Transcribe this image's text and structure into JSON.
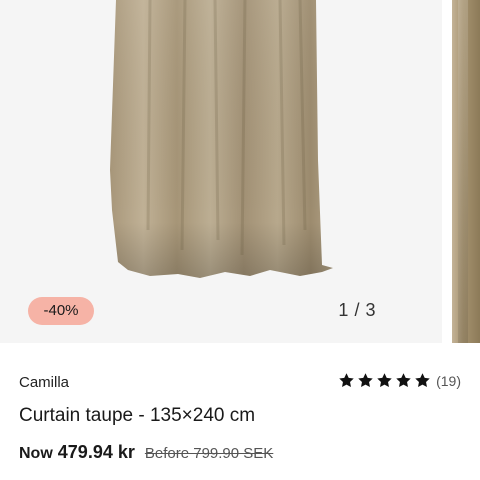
{
  "gallery": {
    "discount_badge": "-40%",
    "current_index": "1",
    "separator": "/",
    "total": "3"
  },
  "product": {
    "brand": "Camilla",
    "title": "Curtain taupe - 135×240 cm",
    "rating": 5,
    "review_count": "(19)",
    "price_label": "Now",
    "price": "479.94 kr",
    "before_price": "Before 799.90 SEK"
  },
  "colors": {
    "badge_bg": "#f6b3a6",
    "curtain": "#b4a484",
    "image_bg": "#f5f5f5"
  }
}
